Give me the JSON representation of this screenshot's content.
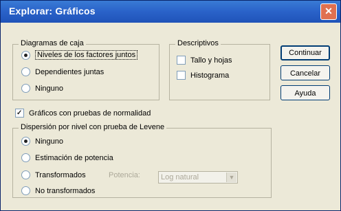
{
  "window": {
    "title": "Explorar: Gráficos",
    "close_glyph": "✕"
  },
  "boxplots": {
    "legend": "Diagramas de caja",
    "options": [
      {
        "label": "Niveles de los factores juntos",
        "selected": true
      },
      {
        "label": "Dependientes juntas",
        "selected": false
      },
      {
        "label": "Ninguno",
        "selected": false
      }
    ]
  },
  "descriptives": {
    "legend": "Descriptivos",
    "options": [
      {
        "label": "Tallo y hojas",
        "checked": false
      },
      {
        "label": "Histograma",
        "checked": false
      }
    ]
  },
  "buttons": {
    "continue": "Continuar",
    "cancel": "Cancelar",
    "help": "Ayuda"
  },
  "normality": {
    "label": "Gráficos con pruebas de normalidad",
    "checked": true
  },
  "levene": {
    "legend": "Dispersión por nivel con prueba de Levene",
    "options": [
      {
        "label": "Ninguno",
        "selected": true
      },
      {
        "label": "Estimación de potencia",
        "selected": false
      },
      {
        "label": "Transformados",
        "selected": false
      },
      {
        "label": "No transformados",
        "selected": false
      }
    ],
    "power_label": "Potencia:",
    "power_value": "Log natural"
  },
  "colors": {
    "titlebar": "#2a62c9",
    "face": "#ece9d8"
  },
  "icons": {
    "close": "close-icon",
    "dropdown": "chevron-down-icon"
  }
}
